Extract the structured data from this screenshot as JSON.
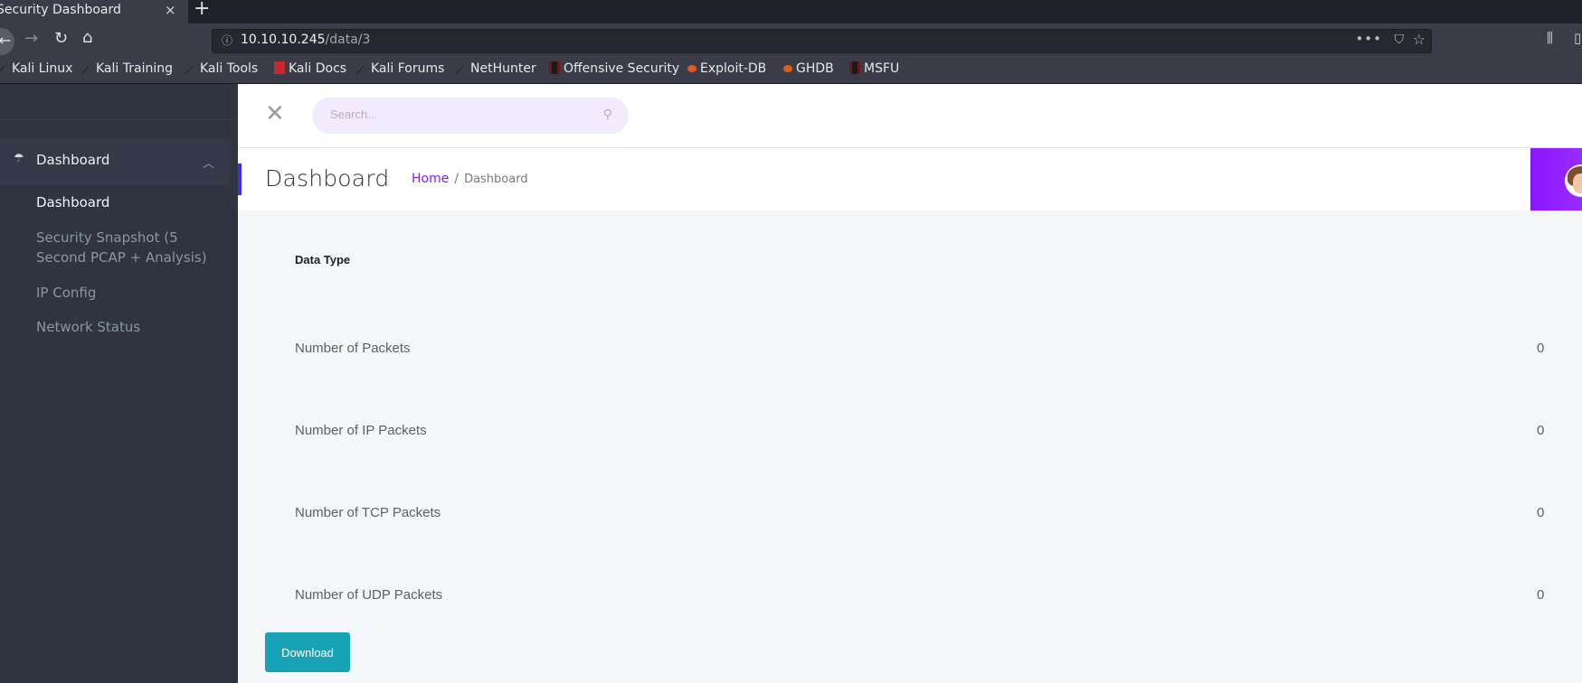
{
  "browser": {
    "tab_title": "Security Dashboard",
    "tab_close_icon": "×",
    "new_tab_icon": "+",
    "url_host": "10.10.10.245",
    "url_path": "/data/3",
    "bookmarks": [
      {
        "label": "Kali Linux",
        "icon": "kali-dragon"
      },
      {
        "label": "Kali Training",
        "icon": "kali-dragon"
      },
      {
        "label": "Kali Tools",
        "icon": "kali-dragon"
      },
      {
        "label": "Kali Docs",
        "icon": "kali-docs"
      },
      {
        "label": "Kali Forums",
        "icon": "kali-dragon"
      },
      {
        "label": "NetHunter",
        "icon": "kali-dragon"
      },
      {
        "label": "Offensive Security",
        "icon": "offsec"
      },
      {
        "label": "Exploit-DB",
        "icon": "exploitdb-bug"
      },
      {
        "label": "GHDB",
        "icon": "exploitdb-bug"
      },
      {
        "label": "MSFU",
        "icon": "offsec"
      }
    ]
  },
  "sidebar": {
    "menu_label": "Dashboard",
    "sub_items": [
      {
        "label": "Dashboard",
        "active": true
      },
      {
        "label": "Security Snapshot (5 Second PCAP + Analysis)",
        "active": false
      },
      {
        "label": "IP Config",
        "active": false
      },
      {
        "label": "Network Status",
        "active": false
      }
    ]
  },
  "topbar": {
    "search_placeholder": "Search..."
  },
  "page": {
    "title": "Dashboard",
    "breadcrumb_home": "Home",
    "breadcrumb_separator": "/",
    "breadcrumb_current": "Dashboard"
  },
  "table": {
    "header": "Data Type",
    "rows": [
      {
        "label": "Number of Packets",
        "value": "0"
      },
      {
        "label": "Number of IP Packets",
        "value": "0"
      },
      {
        "label": "Number of TCP Packets",
        "value": "0"
      },
      {
        "label": "Number of UDP Packets",
        "value": "0"
      }
    ]
  },
  "actions": {
    "download_label": "Download"
  },
  "colors": {
    "accent_purple": "#8a16ff",
    "accent_blue_bar": "#3b2df0",
    "download_button": "#17a2b8",
    "sidebar_bg": "#2e3440"
  }
}
